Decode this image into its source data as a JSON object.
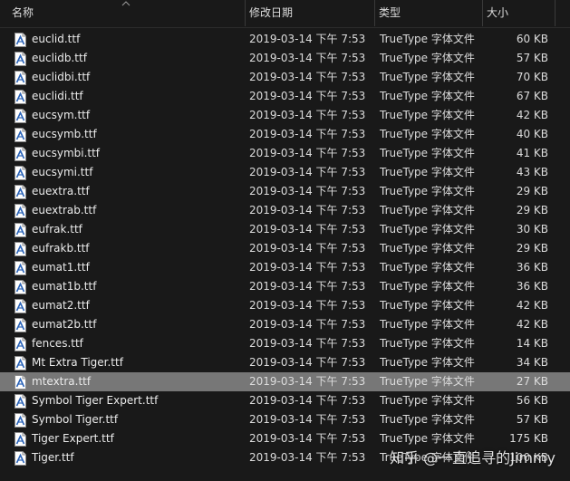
{
  "header": {
    "col_name": "名称",
    "col_date": "修改日期",
    "col_type": "类型",
    "col_size": "大小"
  },
  "files": [
    {
      "name": "euclid.ttf",
      "date": "2019-03-14 下午 7:53",
      "type": "TrueType 字体文件",
      "size": "60 KB"
    },
    {
      "name": "euclidb.ttf",
      "date": "2019-03-14 下午 7:53",
      "type": "TrueType 字体文件",
      "size": "57 KB"
    },
    {
      "name": "euclidbi.ttf",
      "date": "2019-03-14 下午 7:53",
      "type": "TrueType 字体文件",
      "size": "70 KB"
    },
    {
      "name": "euclidi.ttf",
      "date": "2019-03-14 下午 7:53",
      "type": "TrueType 字体文件",
      "size": "67 KB"
    },
    {
      "name": "eucsym.ttf",
      "date": "2019-03-14 下午 7:53",
      "type": "TrueType 字体文件",
      "size": "42 KB"
    },
    {
      "name": "eucsymb.ttf",
      "date": "2019-03-14 下午 7:53",
      "type": "TrueType 字体文件",
      "size": "40 KB"
    },
    {
      "name": "eucsymbi.ttf",
      "date": "2019-03-14 下午 7:53",
      "type": "TrueType 字体文件",
      "size": "41 KB"
    },
    {
      "name": "eucsymi.ttf",
      "date": "2019-03-14 下午 7:53",
      "type": "TrueType 字体文件",
      "size": "43 KB"
    },
    {
      "name": "euextra.ttf",
      "date": "2019-03-14 下午 7:53",
      "type": "TrueType 字体文件",
      "size": "29 KB"
    },
    {
      "name": "euextrab.ttf",
      "date": "2019-03-14 下午 7:53",
      "type": "TrueType 字体文件",
      "size": "29 KB"
    },
    {
      "name": "eufrak.ttf",
      "date": "2019-03-14 下午 7:53",
      "type": "TrueType 字体文件",
      "size": "30 KB"
    },
    {
      "name": "eufrakb.ttf",
      "date": "2019-03-14 下午 7:53",
      "type": "TrueType 字体文件",
      "size": "29 KB"
    },
    {
      "name": "eumat1.ttf",
      "date": "2019-03-14 下午 7:53",
      "type": "TrueType 字体文件",
      "size": "36 KB"
    },
    {
      "name": "eumat1b.ttf",
      "date": "2019-03-14 下午 7:53",
      "type": "TrueType 字体文件",
      "size": "36 KB"
    },
    {
      "name": "eumat2.ttf",
      "date": "2019-03-14 下午 7:53",
      "type": "TrueType 字体文件",
      "size": "42 KB"
    },
    {
      "name": "eumat2b.ttf",
      "date": "2019-03-14 下午 7:53",
      "type": "TrueType 字体文件",
      "size": "42 KB"
    },
    {
      "name": "fences.ttf",
      "date": "2019-03-14 下午 7:53",
      "type": "TrueType 字体文件",
      "size": "14 KB"
    },
    {
      "name": "Mt Extra Tiger.ttf",
      "date": "2019-03-14 下午 7:53",
      "type": "TrueType 字体文件",
      "size": "34 KB"
    },
    {
      "name": "mtextra.ttf",
      "date": "2019-03-14 下午 7:53",
      "type": "TrueType 字体文件",
      "size": "27 KB",
      "selected": true
    },
    {
      "name": "Symbol Tiger Expert.ttf",
      "date": "2019-03-14 下午 7:53",
      "type": "TrueType 字体文件",
      "size": "56 KB"
    },
    {
      "name": "Symbol Tiger.ttf",
      "date": "2019-03-14 下午 7:53",
      "type": "TrueType 字体文件",
      "size": "57 KB"
    },
    {
      "name": "Tiger Expert.ttf",
      "date": "2019-03-14 下午 7:53",
      "type": "TrueType 字体文件",
      "size": "175 KB"
    },
    {
      "name": "Tiger.ttf",
      "date": "2019-03-14 下午 7:53",
      "type": "TrueType 字体文件",
      "size": "100 KB"
    }
  ],
  "icon": "truetype-font-file-icon",
  "colors": {
    "background": "#191919",
    "selected_row": "#777777",
    "text": "#dcdcdc"
  },
  "watermark": "知乎 @一直追寻的Jimmy"
}
